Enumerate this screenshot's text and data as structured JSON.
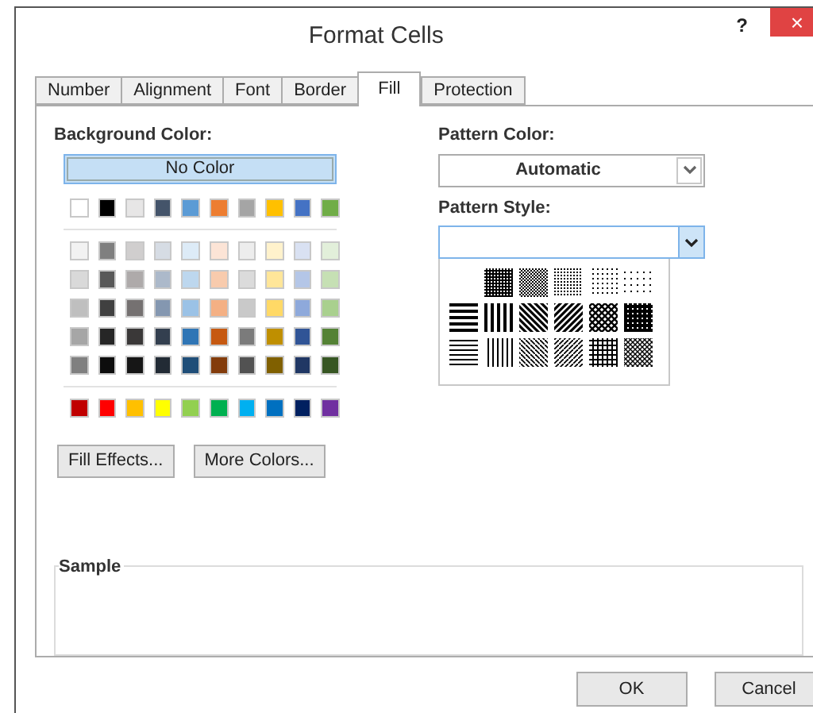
{
  "window": {
    "title": "Format Cells",
    "help": "?",
    "close": "×"
  },
  "tabs": [
    {
      "label": "Number",
      "selected": false
    },
    {
      "label": "Alignment",
      "selected": false
    },
    {
      "label": "Font",
      "selected": false
    },
    {
      "label": "Border",
      "selected": false
    },
    {
      "label": "Fill",
      "selected": true
    },
    {
      "label": "Protection",
      "selected": false
    }
  ],
  "background_color": {
    "label": "Background Color:",
    "no_color": {
      "label": "No Color",
      "selected": true
    },
    "theme_colors": [
      {
        "color": "#ffffff"
      },
      {
        "color": "#000000"
      },
      {
        "color": "#e7e6e6"
      },
      {
        "color": "#44546a"
      },
      {
        "color": "#5b9bd5"
      },
      {
        "color": "#ed7d31"
      },
      {
        "color": "#a5a5a5"
      },
      {
        "color": "#ffc000"
      },
      {
        "color": "#4472c4"
      },
      {
        "color": "#70ad47"
      }
    ],
    "shades": [
      [
        {
          "color": "#f2f2f2"
        },
        {
          "color": "#7f7f7f"
        },
        {
          "color": "#d0cece"
        },
        {
          "color": "#d6dce4"
        },
        {
          "color": "#ddebf7"
        },
        {
          "color": "#fce4d6"
        },
        {
          "color": "#ededed"
        },
        {
          "color": "#fff2cc"
        },
        {
          "color": "#d9e1f2"
        },
        {
          "color": "#e2efda"
        }
      ],
      [
        {
          "color": "#d9d9d9"
        },
        {
          "color": "#595959"
        },
        {
          "color": "#aeaaaa"
        },
        {
          "color": "#acb9ca"
        },
        {
          "color": "#bdd7ee"
        },
        {
          "color": "#f8cbad"
        },
        {
          "color": "#dbdbdb"
        },
        {
          "color": "#ffe699"
        },
        {
          "color": "#b4c6e7"
        },
        {
          "color": "#c6e0b4"
        }
      ],
      [
        {
          "color": "#bfbfbf"
        },
        {
          "color": "#404040"
        },
        {
          "color": "#757171"
        },
        {
          "color": "#8497b0"
        },
        {
          "color": "#9bc2e6"
        },
        {
          "color": "#f4b084"
        },
        {
          "color": "#c9c9c9"
        },
        {
          "color": "#ffd966"
        },
        {
          "color": "#8ea9db"
        },
        {
          "color": "#a9d08e"
        }
      ],
      [
        {
          "color": "#a6a6a6"
        },
        {
          "color": "#262626"
        },
        {
          "color": "#3a3838"
        },
        {
          "color": "#333f4f"
        },
        {
          "color": "#2f75b5"
        },
        {
          "color": "#c65911"
        },
        {
          "color": "#7b7b7b"
        },
        {
          "color": "#bf8f00"
        },
        {
          "color": "#305496"
        },
        {
          "color": "#548235"
        }
      ],
      [
        {
          "color": "#808080"
        },
        {
          "color": "#0d0d0d"
        },
        {
          "color": "#161616"
        },
        {
          "color": "#222b35"
        },
        {
          "color": "#1f4e78"
        },
        {
          "color": "#833c0c"
        },
        {
          "color": "#525252"
        },
        {
          "color": "#806000"
        },
        {
          "color": "#203764"
        },
        {
          "color": "#375623"
        }
      ]
    ],
    "standard_colors": [
      {
        "color": "#c00000"
      },
      {
        "color": "#ff0000"
      },
      {
        "color": "#ffc000"
      },
      {
        "color": "#ffff00"
      },
      {
        "color": "#92d050"
      },
      {
        "color": "#00b050"
      },
      {
        "color": "#00b0f0"
      },
      {
        "color": "#0070c0"
      },
      {
        "color": "#002060"
      },
      {
        "color": "#7030a0"
      }
    ],
    "buttons": [
      "Fill Effects...",
      "More Colors..."
    ]
  },
  "pattern_color": {
    "label": "Pattern Color:",
    "value": "Automatic"
  },
  "pattern_style": {
    "label": "Pattern Style:",
    "expanded": true
  },
  "sample": {
    "label": "Sample"
  },
  "buttons": [
    "OK",
    "Cancel"
  ]
}
